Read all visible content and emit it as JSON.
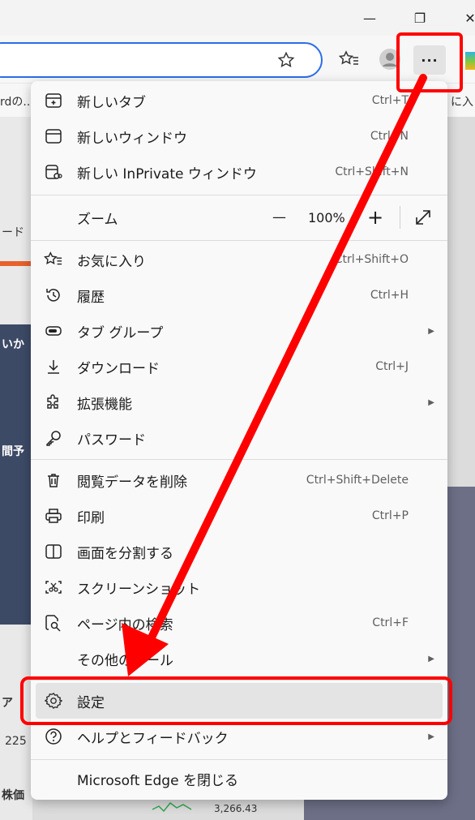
{
  "window": {
    "minimize_glyph": "—",
    "restore_glyph": "❐",
    "close_glyph": "✕"
  },
  "bookmarks": [
    {
      "text": "rdの..."
    },
    {
      "text": "に入"
    }
  ],
  "background": {
    "fragment_1": "ード",
    "fragment_2": "いか",
    "fragment_3": "間予",
    "fragment_4": "ア",
    "fragment_5": "225",
    "fragment_6": "株価",
    "value": "3,266.43"
  },
  "menu": {
    "items": [
      {
        "id": "new-tab",
        "label": "新しいタブ",
        "shortcut": "Ctrl+T",
        "icon": "new-tab-icon"
      },
      {
        "id": "new-window",
        "label": "新しいウィンドウ",
        "shortcut": "Ctrl+N",
        "icon": "window-icon"
      },
      {
        "id": "new-inprivate",
        "label": "新しい InPrivate ウィンドウ",
        "shortcut": "Ctrl+Shift+N",
        "icon": "inprivate-icon"
      },
      {
        "id": "favorites",
        "label": "お気に入り",
        "shortcut": "Ctrl+Shift+O",
        "icon": "favorites-icon"
      },
      {
        "id": "history",
        "label": "履歴",
        "shortcut": "Ctrl+H",
        "icon": "history-icon"
      },
      {
        "id": "tab-groups",
        "label": "タブ グループ",
        "shortcut": "",
        "icon": "tab-groups-icon"
      },
      {
        "id": "downloads",
        "label": "ダウンロード",
        "shortcut": "Ctrl+J",
        "icon": "download-icon"
      },
      {
        "id": "extensions",
        "label": "拡張機能",
        "shortcut": "",
        "icon": "extensions-icon"
      },
      {
        "id": "passwords",
        "label": "パスワード",
        "shortcut": "",
        "icon": "key-icon"
      },
      {
        "id": "clear-data",
        "label": "閲覧データを削除",
        "shortcut": "Ctrl+Shift+Delete",
        "icon": "trash-icon"
      },
      {
        "id": "print",
        "label": "印刷",
        "shortcut": "Ctrl+P",
        "icon": "printer-icon"
      },
      {
        "id": "split-screen",
        "label": "画面を分割する",
        "shortcut": "",
        "icon": "split-screen-icon"
      },
      {
        "id": "screenshot",
        "label": "スクリーンショット",
        "shortcut": "",
        "icon": "screenshot-icon"
      },
      {
        "id": "find-on-page",
        "label": "ページ内の検索",
        "shortcut": "Ctrl+F",
        "icon": "find-icon"
      },
      {
        "id": "more-tools",
        "label": "その他のツール",
        "shortcut": "",
        "icon": ""
      },
      {
        "id": "settings",
        "label": "設定",
        "shortcut": "",
        "icon": "gear-icon"
      },
      {
        "id": "help",
        "label": "ヘルプとフィードバック",
        "shortcut": "",
        "icon": "help-icon"
      },
      {
        "id": "close-edge",
        "label": "Microsoft Edge を閉じる",
        "shortcut": "",
        "icon": ""
      }
    ],
    "zoom": {
      "label": "ズーム",
      "minus": "—",
      "value": "100%",
      "plus": "+"
    }
  },
  "colors": {
    "highlight": "#ff0000",
    "accent": "#2b6de8"
  }
}
